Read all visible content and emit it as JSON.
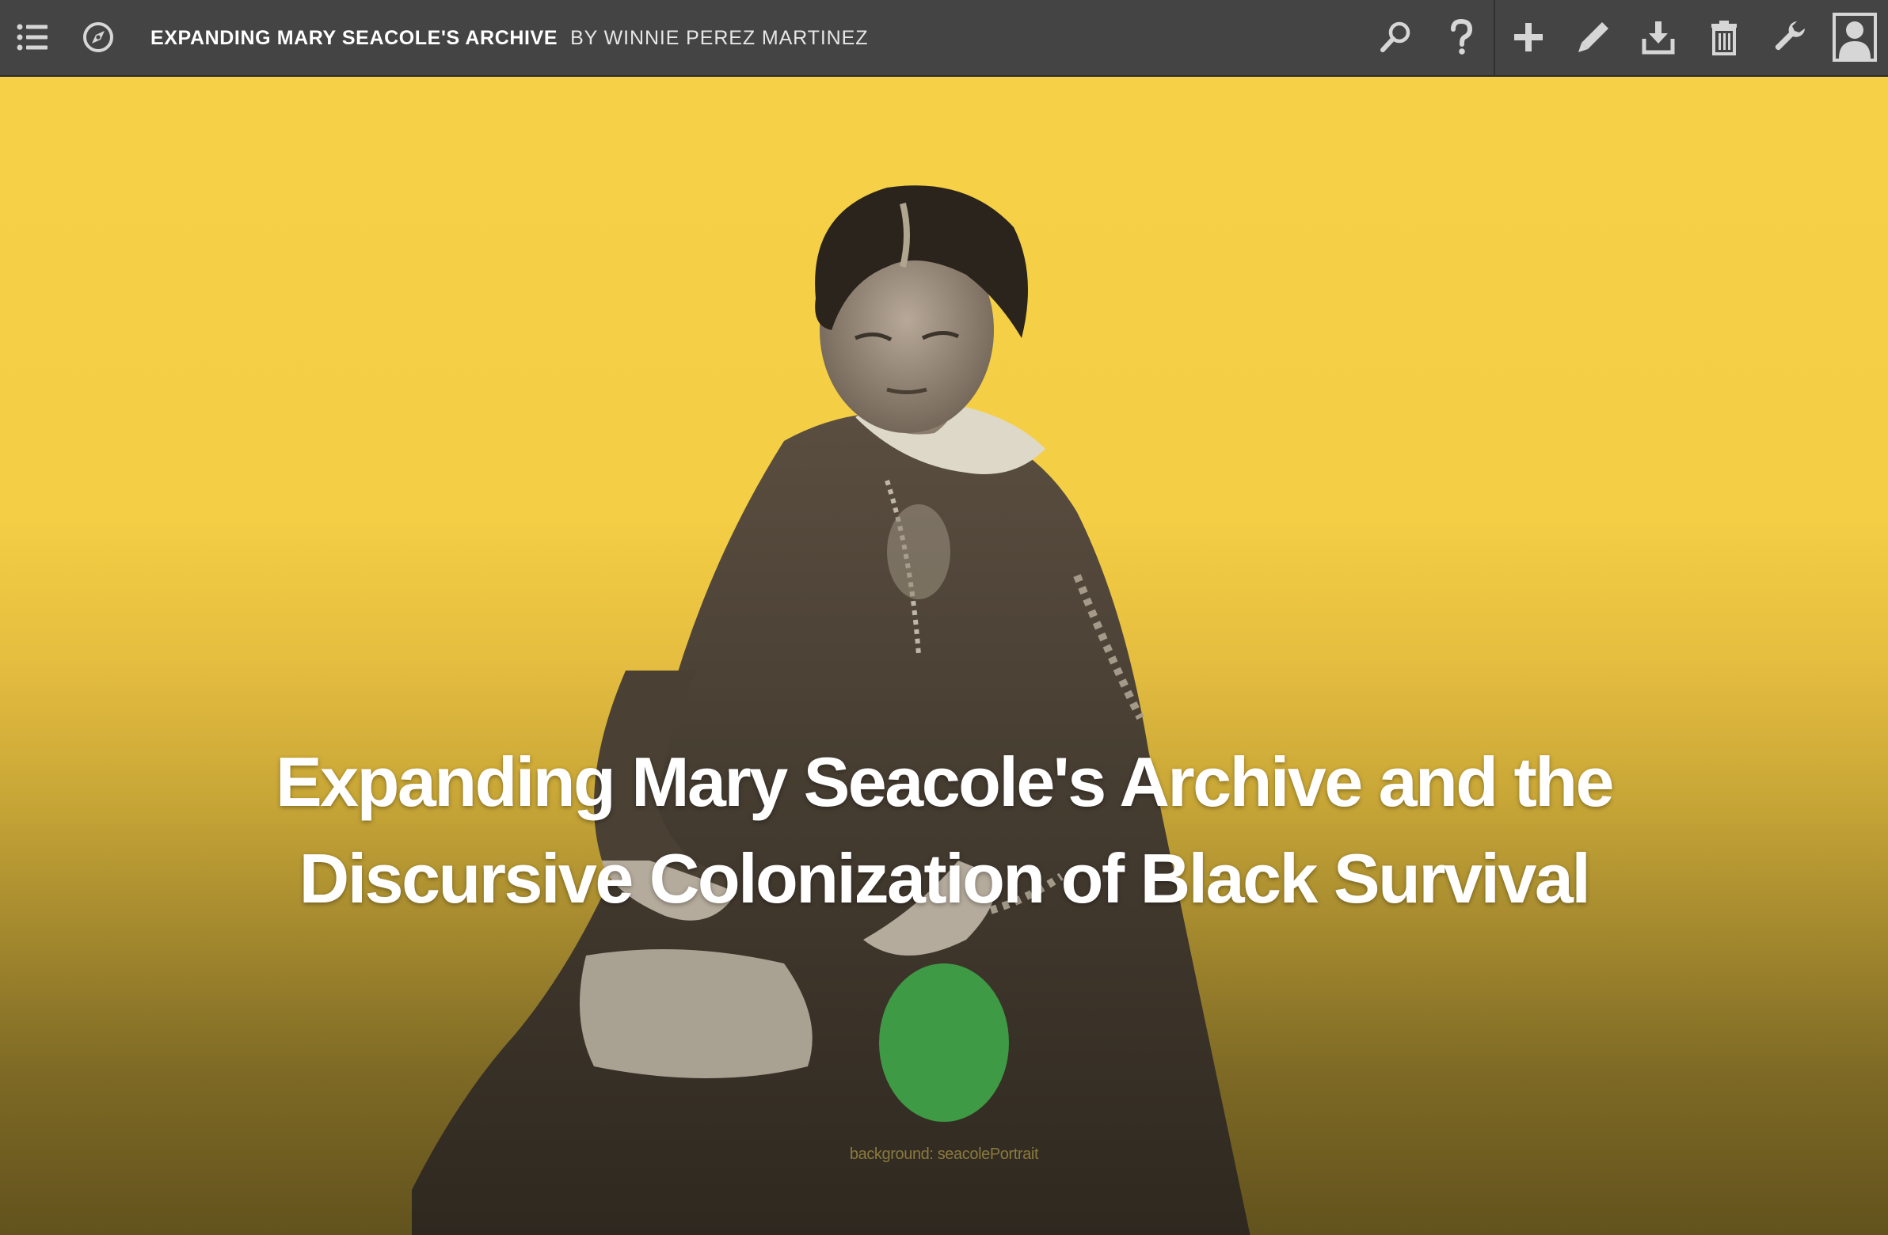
{
  "toolbar": {
    "title": "EXPANDING MARY SEACOLE'S ARCHIVE",
    "byline": "BY WINNIE PEREZ MARTINEZ",
    "icons_left": [
      "list-icon",
      "compass-icon"
    ],
    "icons_right": [
      "search-icon",
      "help-icon",
      "add-icon",
      "pencil-icon",
      "download-icon",
      "trash-icon",
      "wrench-icon",
      "user-icon"
    ],
    "background": "#444444",
    "icon_color": "#d6d6d6"
  },
  "hero": {
    "title": "Expanding Mary Seacole's Archive and the Discursive Colonization of Black Survival",
    "background_label": "background: seacolePortrait",
    "gradient_top": "#f6d147",
    "gradient_bottom": "#62521d",
    "accent_dot_color": "#3f9a45"
  }
}
